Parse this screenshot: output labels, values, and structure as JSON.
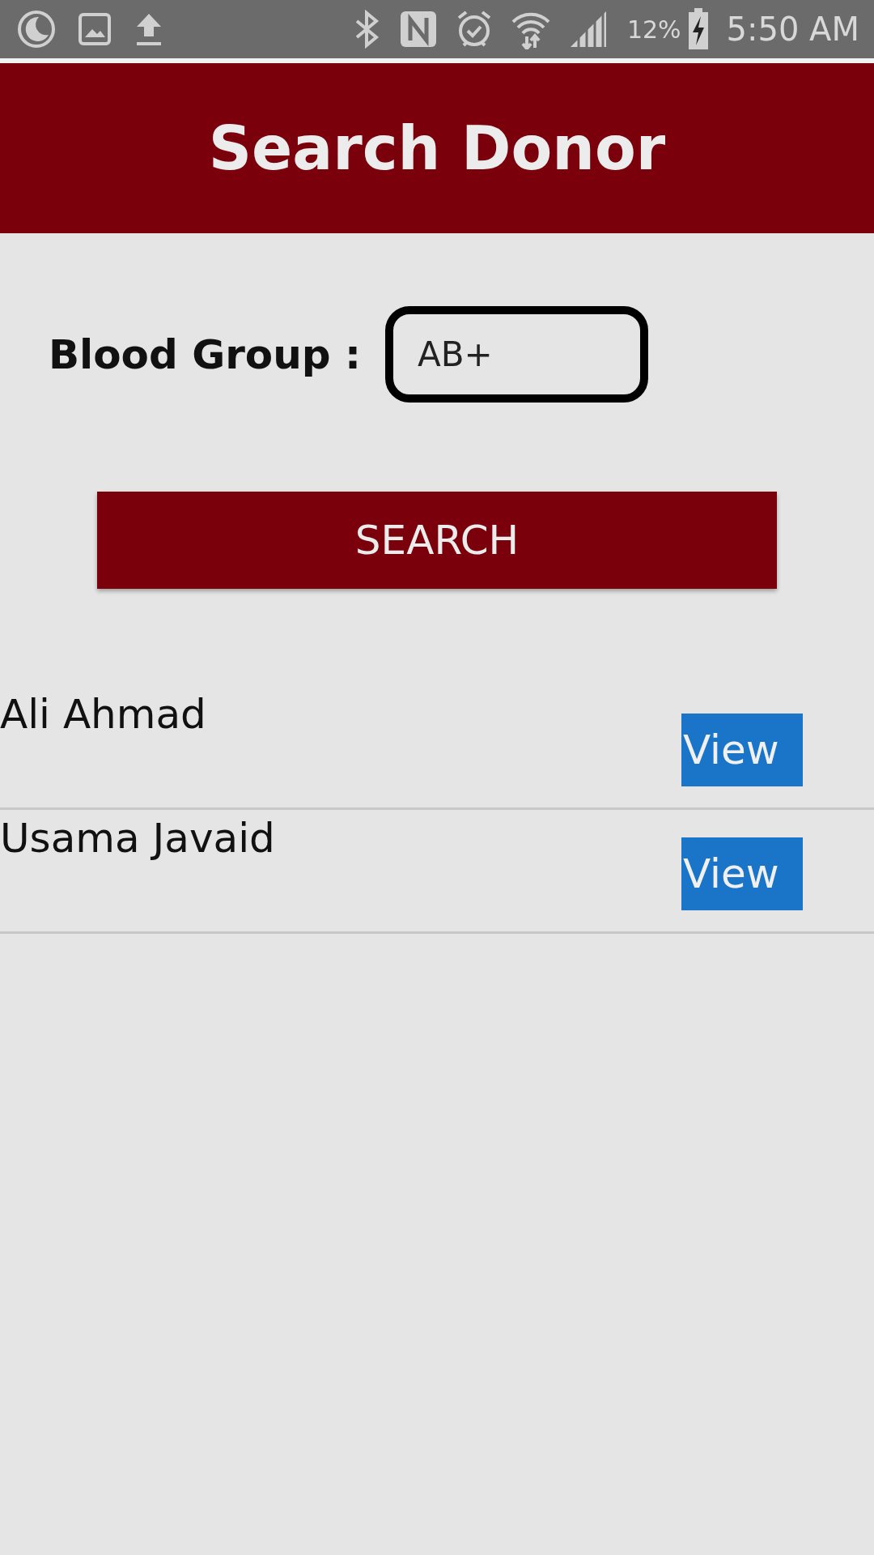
{
  "status_bar": {
    "battery": "12%",
    "time": "5:50 AM"
  },
  "header": {
    "title": "Search Donor"
  },
  "form": {
    "label": "Blood Group :",
    "value": "AB+",
    "button": "SEARCH"
  },
  "donors": [
    {
      "name": "Ali Ahmad",
      "action": "View"
    },
    {
      "name": "Usama Javaid",
      "action": "View"
    }
  ]
}
